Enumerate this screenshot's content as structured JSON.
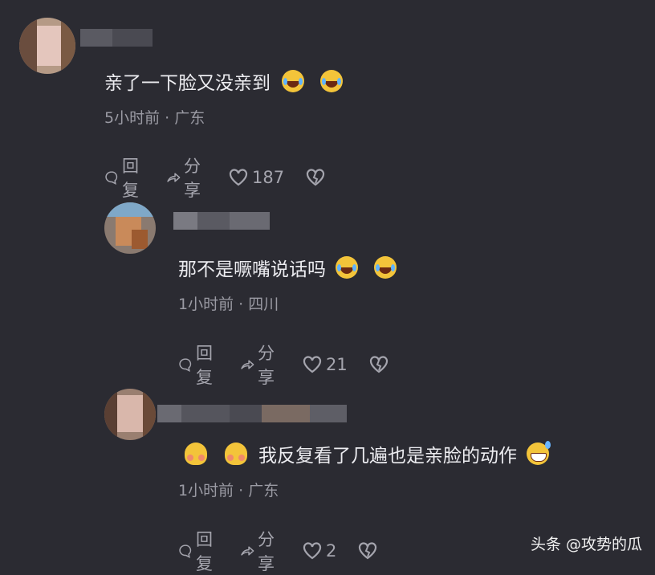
{
  "comments": [
    {
      "text": "亲了一下脸又没亲到",
      "meta": "5小时前 · 广东",
      "reply_label": "回复",
      "share_label": "分享",
      "like_count": "187"
    },
    {
      "text": "那不是噘嘴说话吗",
      "meta": "1小时前 · 四川",
      "reply_label": "回复",
      "share_label": "分享",
      "like_count": "21"
    },
    {
      "text": "我反复看了几遍也是亲脸的动作",
      "meta": "1小时前 · 广东",
      "reply_label": "回复",
      "share_label": "分享",
      "like_count": "2"
    }
  ],
  "watermark": "头条 @攻势的瓜",
  "icons": {
    "reply": "speech-bubble-icon",
    "share": "share-arrow-icon",
    "like": "heart-icon",
    "dislike": "broken-heart-icon",
    "emoji_laugh": "tears-of-joy-emoji",
    "emoji_shy": "shy-face-emoji",
    "emoji_sweat": "grinning-sweat-emoji"
  },
  "colors": {
    "background": "#2b2b32",
    "text": "#ececf0",
    "meta": "#9a9aa3"
  }
}
